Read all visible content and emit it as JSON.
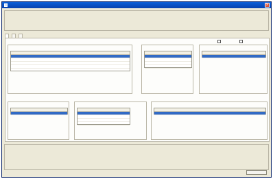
{
  "window": {
    "title": "",
    "close_symbol": "×"
  },
  "summary": {
    "title": "",
    "labels": [
      "",
      "",
      "",
      "",
      "",
      ""
    ],
    "values": [
      "",
      "",
      "",
      "",
      "",
      ""
    ]
  },
  "tabs": [
    {
      "label": "",
      "active": true
    },
    {
      "label": "",
      "active": false
    },
    {
      "label": "",
      "active": false
    }
  ],
  "options": {
    "detail_label": "",
    "percentage_label": ""
  },
  "panels": {
    "top_left": {
      "title": "",
      "columns": [
        "",
        "",
        "",
        ""
      ],
      "rows": [
        [
          "",
          "",
          "",
          ""
        ],
        [
          "",
          "",
          "",
          ""
        ],
        [
          "",
          "",
          "",
          ""
        ],
        [
          "",
          "",
          "",
          ""
        ]
      ]
    },
    "top_mid": {
      "title": "",
      "columns": [
        "",
        ""
      ],
      "rows": [
        [
          "",
          ""
        ],
        [
          "",
          ""
        ],
        [
          "",
          ""
        ],
        [
          "",
          ""
        ]
      ]
    },
    "top_right": {
      "title": "",
      "columns": [
        "",
        "",
        "",
        ""
      ],
      "rows": [
        [
          "",
          "",
          "",
          ""
        ]
      ]
    },
    "bottom_left": {
      "title": "",
      "columns": [
        "",
        ""
      ],
      "rows": [
        [
          "",
          ""
        ]
      ]
    },
    "bottom_mid": {
      "title": "",
      "columns": [
        "",
        ""
      ],
      "rows": [
        [
          "",
          ""
        ],
        [
          "",
          ""
        ],
        [
          "",
          ""
        ],
        [
          "",
          ""
        ]
      ]
    },
    "bottom_right": {
      "title": "",
      "columns": [
        "",
        ""
      ],
      "rows": [
        [
          "",
          ""
        ]
      ]
    }
  },
  "footer": {
    "title": "",
    "labels": [
      "",
      "",
      "",
      "",
      "",
      "",
      "",
      ""
    ],
    "values": [
      "",
      "",
      "",
      "",
      "",
      "",
      "",
      ""
    ]
  },
  "cancel_label": "",
  "colors": {
    "titlebar": "#0a5fd8",
    "selection": "#316ac5",
    "section_title": "#1f3f94",
    "window_bg": "#ece9d8"
  }
}
